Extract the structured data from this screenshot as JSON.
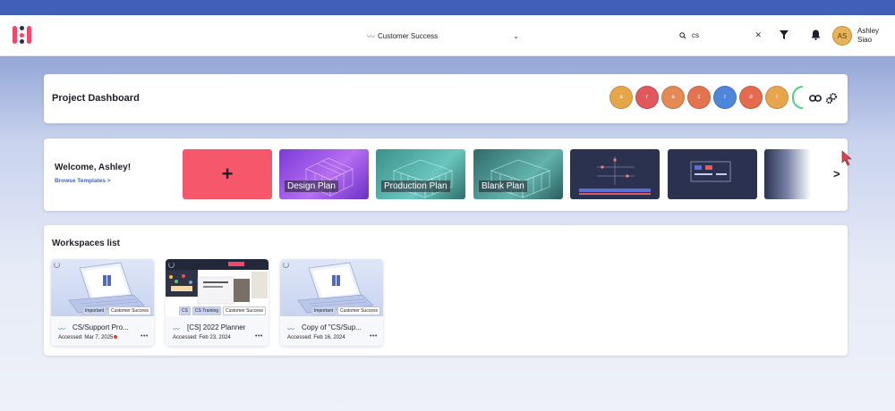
{
  "header": {
    "team_select": "Customer Success",
    "search_value": "cs",
    "user_initials": "AS",
    "user_name_first": "Ashley",
    "user_name_last": "Siao"
  },
  "dashboard": {
    "title": "Project Dashboard",
    "members": [
      {
        "initial": "a",
        "color": "#e5a64a"
      },
      {
        "initial": "r",
        "color": "#e0575e"
      },
      {
        "initial": "a",
        "color": "#e48a55"
      },
      {
        "initial": "z",
        "color": "#e4734f"
      },
      {
        "initial": "t",
        "color": "#4f85db"
      },
      {
        "initial": "d",
        "color": "#e46b4d"
      },
      {
        "initial": "l",
        "color": "#e8a54d"
      }
    ]
  },
  "welcome": {
    "title": "Welcome, Ashley!",
    "browse_link": "Browse Templates >",
    "add_symbol": "+",
    "templates": [
      "Design Plan",
      "Production Plan",
      "Blank Plan"
    ],
    "next_symbol": ">"
  },
  "workspaces": {
    "title": "Workspaces list",
    "items": [
      {
        "name": "CS/Support Pro...",
        "accessed": "Accessed: Mar 7, 2025",
        "tags": [
          "Important",
          "Customer Success"
        ]
      },
      {
        "name": "[CS] 2022 Planner",
        "accessed": "Accessed: Feb 23, 2024",
        "tags": [
          "CS",
          "CS Training",
          "Customer Success"
        ]
      },
      {
        "name": "Copy of \"CS/Sup...",
        "accessed": "Accessed: Feb 16, 2024",
        "tags": [
          "Important",
          "Customer Success"
        ]
      }
    ],
    "more_label": "•••"
  }
}
